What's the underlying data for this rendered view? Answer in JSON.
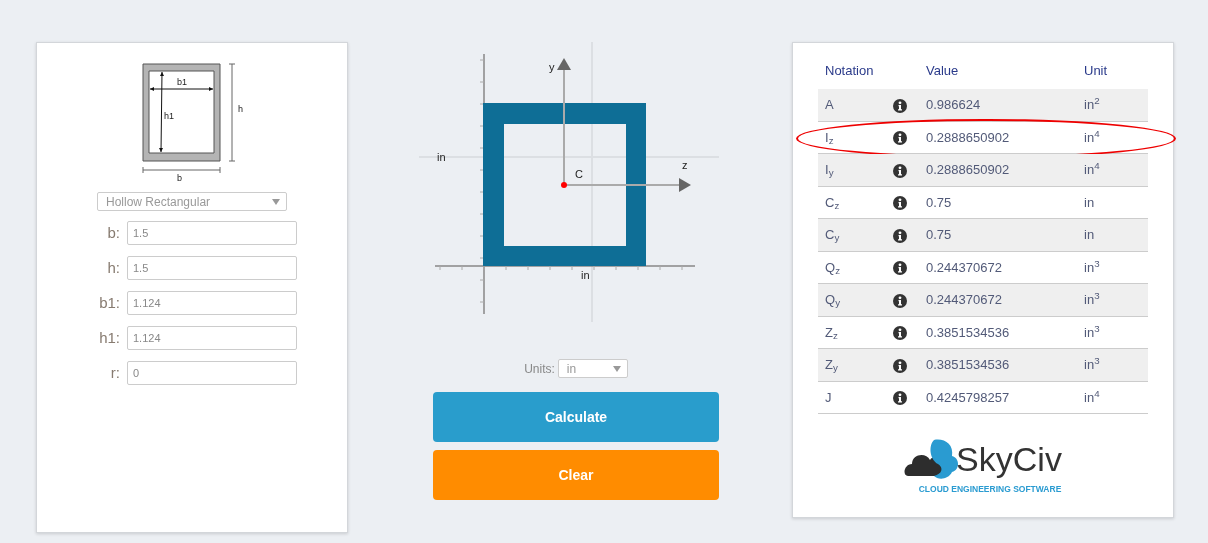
{
  "section_diagram": {
    "inner_width_label": "b1",
    "inner_height_label": "h1",
    "height_label": "h",
    "width_label": "b"
  },
  "shape_select": {
    "value": "Hollow Rectangular"
  },
  "inputs": [
    {
      "label": "b:",
      "value": "1.5"
    },
    {
      "label": "h:",
      "value": "1.5"
    },
    {
      "label": "b1:",
      "value": "1.124"
    },
    {
      "label": "h1:",
      "value": "1.124"
    },
    {
      "label": "r:",
      "value": "0"
    }
  ],
  "plot": {
    "y_axis_label": "y",
    "z_axis_label": "z",
    "centroid_label": "C",
    "left_unit_label": "in",
    "bottom_unit_label": "in"
  },
  "units": {
    "label": "Units:",
    "value": "in"
  },
  "buttons": [
    {
      "label": "Calculate",
      "kind": "primary"
    },
    {
      "label": "Clear",
      "kind": "secondary"
    }
  ],
  "results": {
    "columns": [
      "Notation",
      "Value",
      "Unit"
    ],
    "rows": [
      {
        "notation": "A",
        "value": "0.986624",
        "unit": "in$^{2}$",
        "circled": false
      },
      {
        "notation": "I$_{z}$",
        "value": "0.2888650902",
        "unit": "in$^{4}$",
        "circled": true
      },
      {
        "notation": "I$_{y}$",
        "value": "0.2888650902",
        "unit": "in$^{4}$",
        "circled": false
      },
      {
        "notation": "C$_{z}$",
        "value": "0.75",
        "unit": "in",
        "circled": false
      },
      {
        "notation": "C$_{y}$",
        "value": "0.75",
        "unit": "in",
        "circled": false
      },
      {
        "notation": "Q$_{z}$",
        "value": "0.244370672",
        "unit": "in$^{3}$",
        "circled": false
      },
      {
        "notation": "Q$_{y}$",
        "value": "0.244370672",
        "unit": "in$^{3}$",
        "circled": false
      },
      {
        "notation": "Z$_{z}$",
        "value": "0.3851534536",
        "unit": "in$^{3}$",
        "circled": false
      },
      {
        "notation": "Z$_{y}$",
        "value": "0.3851534536",
        "unit": "in$^{3}$",
        "circled": false
      },
      {
        "notation": "J",
        "value": "0.4245798257",
        "unit": "in$^{4}$",
        "circled": false
      }
    ]
  },
  "logo": {
    "name": "SkyCiv",
    "tagline": "CLOUD ENGINEERING SOFTWARE"
  }
}
